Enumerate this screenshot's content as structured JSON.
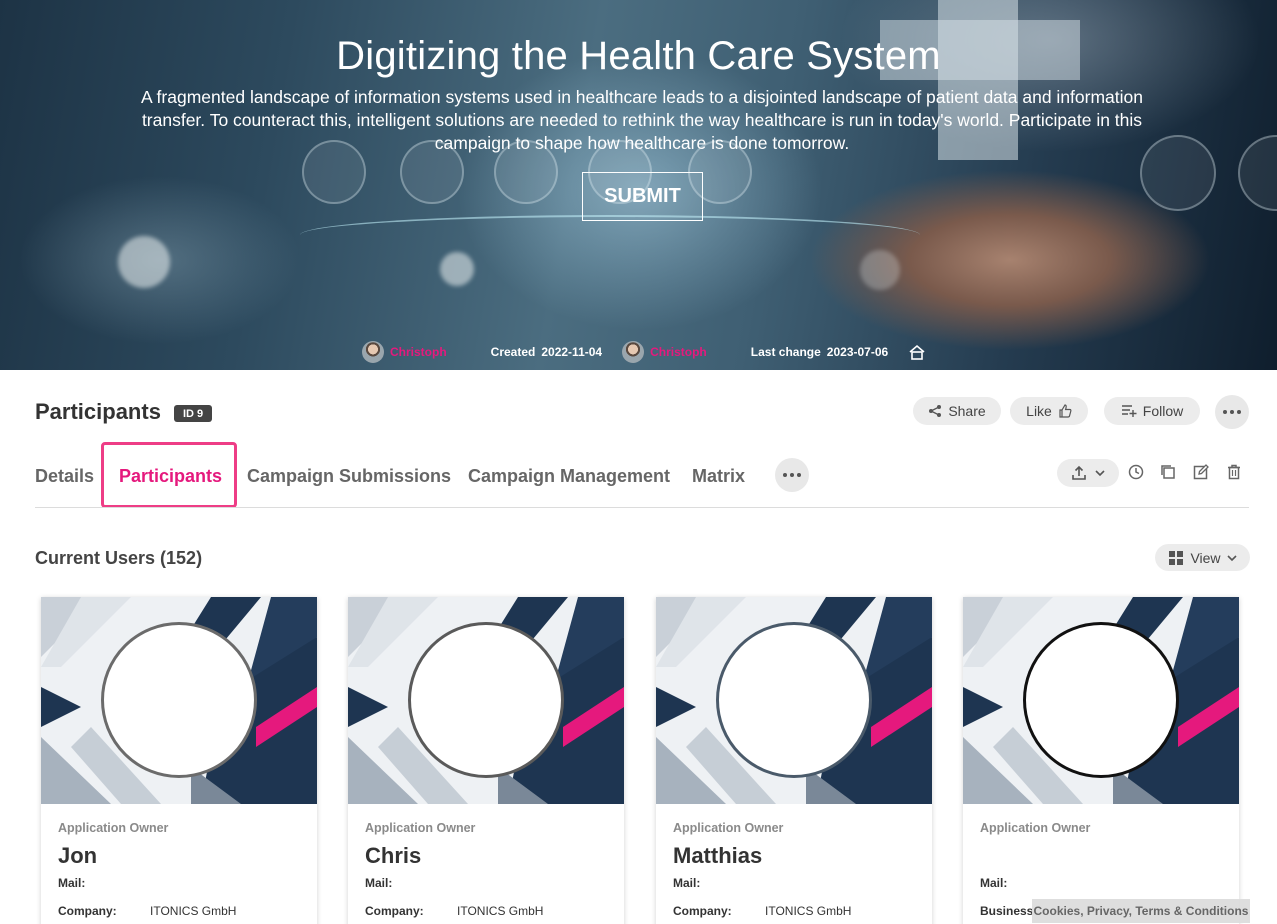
{
  "hero": {
    "title": "Digitizing the Health Care System",
    "description": "A fragmented landscape of information systems used in healthcare leads to a disjointed landscape of patient data and information transfer. To counteract this, intelligent solutions are needed to rethink the way healthcare is run in today's world. Participate in this campaign to shape how healthcare is done tomorrow.",
    "submit_label": "SUBMIT",
    "meta": {
      "creator": "Christoph",
      "created_label": "Created",
      "created_date": "2022-11-04",
      "editor": "Christoph",
      "last_change_label": "Last change",
      "last_change_date": "2023-07-06"
    }
  },
  "header": {
    "title": "Participants",
    "id_badge": "ID 9",
    "share_label": "Share",
    "like_label": "Like",
    "follow_label": "Follow"
  },
  "tabs": [
    {
      "label": "Details"
    },
    {
      "label": "Participants",
      "active": true
    },
    {
      "label": "Campaign Submissions"
    },
    {
      "label": "Campaign Management"
    },
    {
      "label": "Matrix"
    }
  ],
  "users": {
    "title": "Current Users (152)",
    "view_label": "View",
    "cards": [
      {
        "role": "Application Owner",
        "name": "Jon",
        "mail_label": "Mail:",
        "mail": "",
        "company_label": "Company:",
        "company": "ITONICS GmbH"
      },
      {
        "role": "Application Owner",
        "name": "Chris",
        "mail_label": "Mail:",
        "mail": "",
        "company_label": "Company:",
        "company": "ITONICS GmbH"
      },
      {
        "role": "Application Owner",
        "name": "Matthias",
        "mail_label": "Mail:",
        "mail": "",
        "company_label": "Company:",
        "company": "ITONICS GmbH"
      },
      {
        "role": "Application Owner",
        "name": "",
        "mail_label": "Mail:",
        "mail": "",
        "company_label": "Business",
        "company": ""
      }
    ]
  },
  "footer": {
    "cookie_label": "Cookies, Privacy, Terms & Conditions"
  },
  "colors": {
    "accent": "#e5197d",
    "highlight_border": "#ee3d86"
  }
}
